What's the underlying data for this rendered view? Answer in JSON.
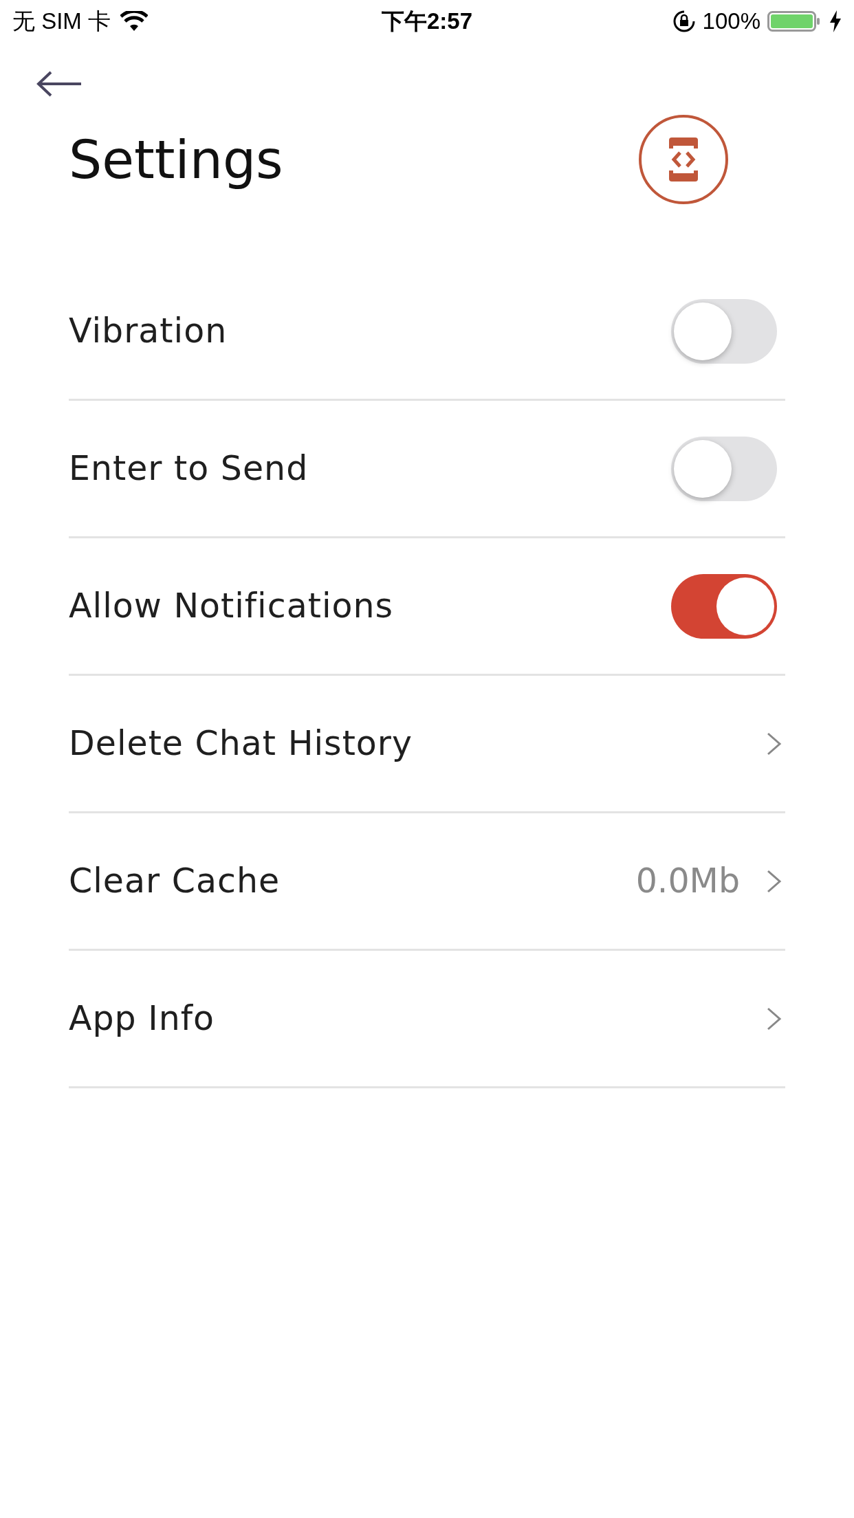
{
  "status_bar": {
    "carrier": "无 SIM 卡",
    "time": "下午2:57",
    "battery": "100%"
  },
  "title": "Settings",
  "rows": [
    {
      "kind": "toggle",
      "label": "Vibration",
      "on": false
    },
    {
      "kind": "toggle",
      "label": "Enter to Send",
      "on": false
    },
    {
      "kind": "toggle",
      "label": "Allow Notifications",
      "on": true
    },
    {
      "kind": "link",
      "label": "Delete Chat History"
    },
    {
      "kind": "link",
      "label": "Clear Cache",
      "value": "0.0Mb"
    },
    {
      "kind": "link",
      "label": "App Info"
    }
  ]
}
